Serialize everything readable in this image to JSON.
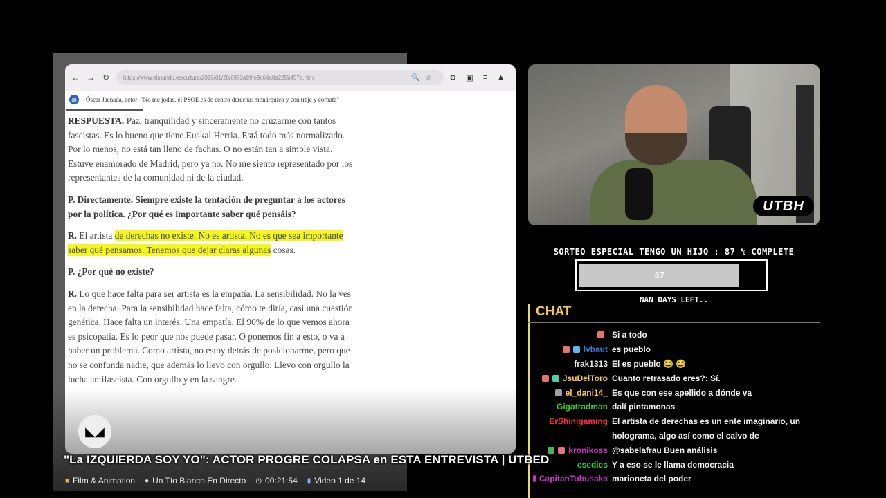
{
  "browser": {
    "url": "https://www.elmundo.es/cultura/2026/01/28/6973a99fe9c64a8a228b457e.html",
    "headline": "Óscar Jaenada, actor: \"No me jodas, el PSOE es de centro derecha: monárquico y con traje y corbata\""
  },
  "article": {
    "p1_lead": "RESPUESTA.",
    "p1_text": " Paz, tranquilidad y sinceramente no cruzarme con tantos fascistas. Es lo bueno que tiene Euskal Herria. Está todo más normalizado. Por lo menos, no está tan lleno de fachas. O no están tan a simple vista. Estuve enamorado de Madrid, pero ya no. No me siento representado por los representantes de la comunidad ni de la ciudad.",
    "q1": "P. Directamente. Siempre existe la tentación de preguntar a los actores por la política. ¿Por qué es importante saber qué pensáis?",
    "p2_lead": "R.",
    "p2_plain": " El artista ",
    "p2_highlight": "de derechas no existe. No es artista. No es que sea importante saber qué pensamos. Tenemos que dejar claras algunas",
    "p2_tail": " cosas.",
    "q2": "P. ¿Por qué no existe?",
    "p3_lead": "R.",
    "p3_text": " Lo que hace falta para ser artista es la empatía. La sensibilidad. No la ves en la derecha. Para la sensibilidad hace falta, cómo te diría, casi una cuestión genética. Hace falta un interés. Una empatía. El 90% de lo que vemos ahora es psicopatía. Es lo peor que nos puede pasar. O ponemos fin a esto, o va a haber un problema. Como artista, no estoy detrás de posicionarme, pero que no se confunda nadie, que además lo llevo con orgullo. Llevo con orgullo la lucha antifascista. Con orgullo y en la sangre."
  },
  "webcam": {
    "logo": "UTBH"
  },
  "raffle": {
    "title": "SORTEO ESPECIAL TENGO UN HIJO : 87 % COMPLETE",
    "progress_value": "87",
    "progress_fraction": 0.87,
    "days_left": "NAN DAYS LEFT.."
  },
  "chat": {
    "title": "CHAT",
    "messages": [
      {
        "user": "",
        "user_color": "#2233cc",
        "badges": [
          "#e57373"
        ],
        "text": "Si a todo"
      },
      {
        "user": "lvbaut",
        "user_color": "#3a7bd5",
        "badges": [
          "#e57373",
          "#64b5f6"
        ],
        "text": "es pueblo"
      },
      {
        "user": "frak1313",
        "user_color": "#e0e0e0",
        "badges": [],
        "text": "El es pueblo 😂 😂"
      },
      {
        "user": "JsuDelToro",
        "user_color": "#f5c84a",
        "badges": [
          "#e57373",
          "#4dd0a1"
        ],
        "text": "Cuanto retrasado eres?: Sí."
      },
      {
        "user": "el_dani14_",
        "user_color": "#f5c84a",
        "badges": [
          "#9e9e9e"
        ],
        "text": "Es que con ese apellido a dónde va"
      },
      {
        "user": "Gigatradman",
        "user_color": "#33cc33",
        "badges": [],
        "text": "dalí pintamonas"
      },
      {
        "user": "ErShinigaming",
        "user_color": "#ff3333",
        "badges": [],
        "text": "El artista de derechas es un ente imaginario, un"
      },
      {
        "user": "",
        "user_color": "#ffffff",
        "badges": [],
        "text": "holograma, algo así como el calvo de"
      },
      {
        "user": "kronikoss",
        "user_color": "#cc33cc",
        "badges": [
          "#4caf50",
          "#e57373"
        ],
        "text": "@sabelafrau Buen análisis"
      },
      {
        "user": "esedies",
        "user_color": "#33cc33",
        "badges": [],
        "text": "Y a eso se le llama democracia"
      },
      {
        "user": "CapitanTubusaka",
        "user_color": "#cc33cc",
        "badges": [
          "#cc33cc"
        ],
        "text": "marioneta del poder"
      }
    ]
  },
  "video": {
    "title": "\"La IZQUIERDA SOY YO\": ACTOR PROGRE COLAPSA en ESTA ENTREVISTA | UTBED",
    "category": "Film & Animation",
    "channel": "Un Tío Blanco En Directo",
    "duration": "00:21:54",
    "playlist_position": "Video 1 de 14"
  }
}
